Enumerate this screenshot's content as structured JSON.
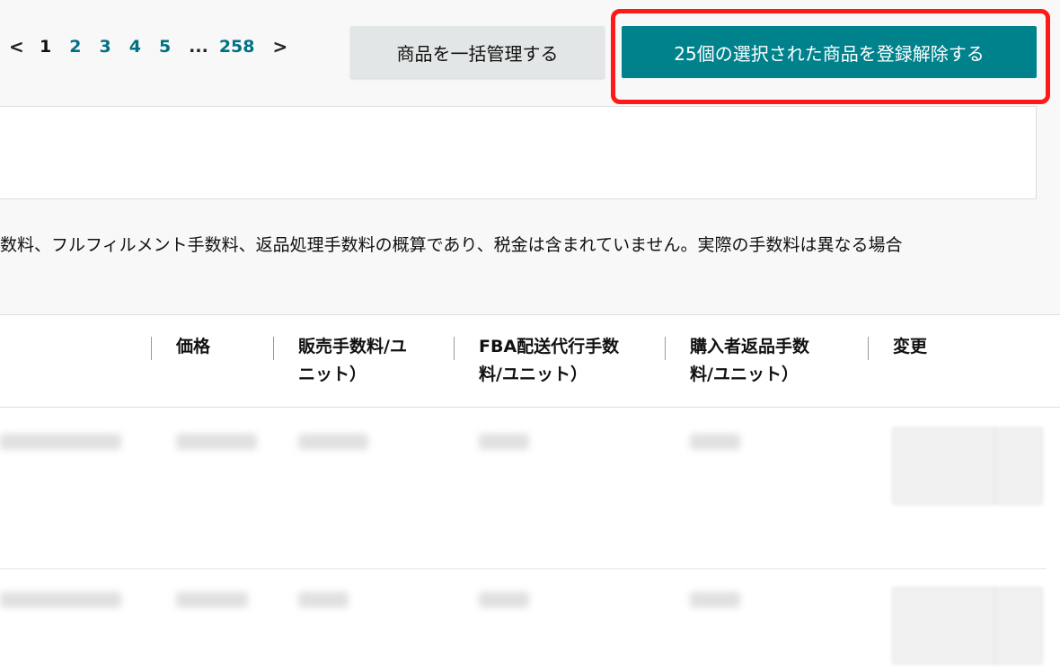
{
  "pagination": {
    "prev_label": "<",
    "pages": [
      "1",
      "2",
      "3",
      "4",
      "5"
    ],
    "ellipsis": "...",
    "last_page": "258",
    "next_label": ">"
  },
  "actions": {
    "bulk_manage_label": "商品を一括管理する",
    "delist_selected_label": "25個の選択された商品を登録解除する"
  },
  "notice": {
    "text": "数料、フルフィルメント手数料、返品処理手数料の概算であり、税金は含まれていません。実際の手数料は異なる場合"
  },
  "table": {
    "columns": {
      "price": "価格",
      "sales_fee": [
        "販売手数料/ユ",
        "ニット）"
      ],
      "fba_fee": [
        "FBA配送代行手数",
        "料/ユニット）"
      ],
      "return_fee": [
        "購入者返品手数",
        "料/ユニット）"
      ],
      "change": "変更"
    }
  },
  "colors": {
    "primary_button": "#00828c",
    "secondary_button": "#e3e6e6",
    "link": "#007185",
    "highlight": "#ff1a1a"
  }
}
